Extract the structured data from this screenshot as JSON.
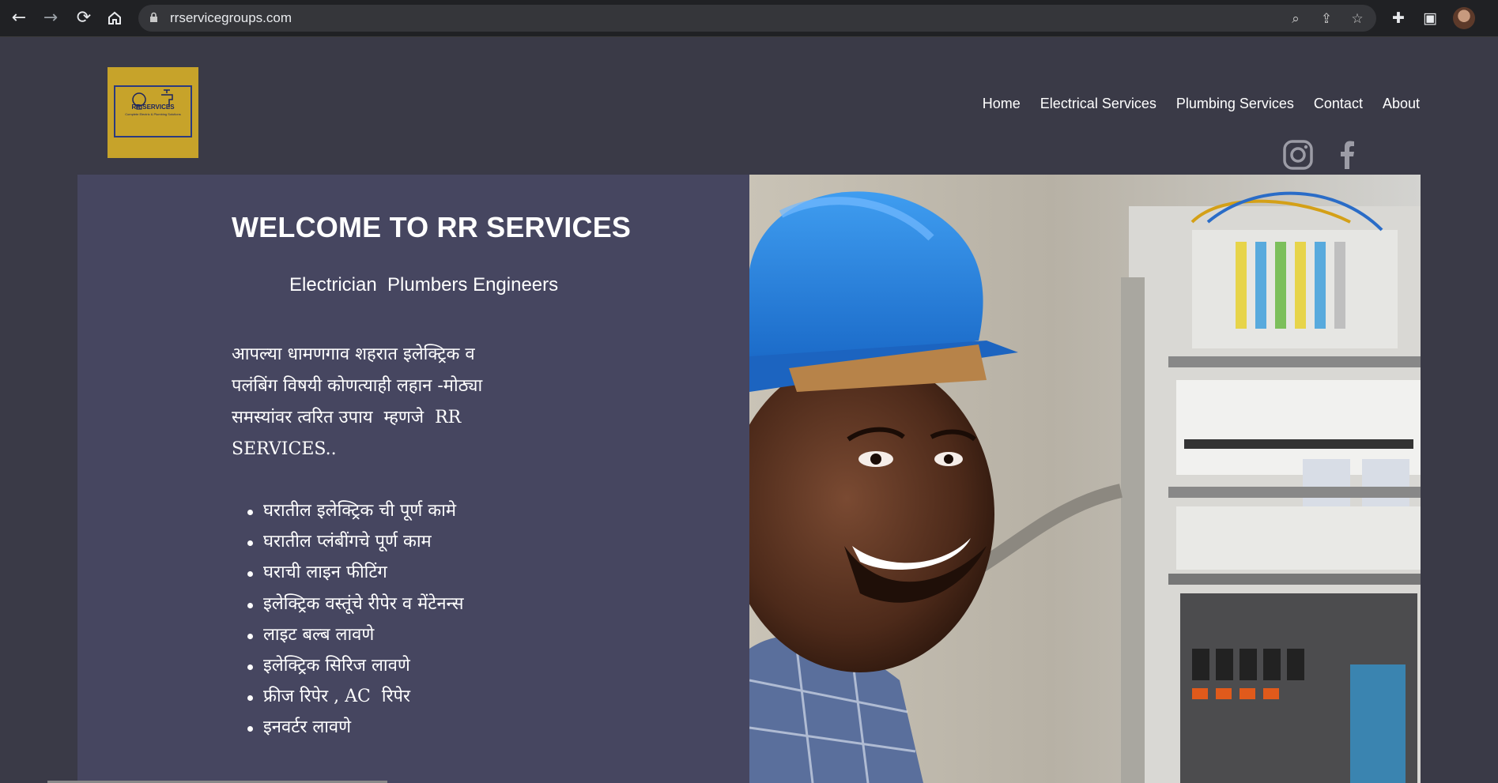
{
  "browser": {
    "url": "rrservicegroups.com"
  },
  "site": {
    "logo": {
      "title": "RR SERVICES",
      "tagline": "Complete Electric & Plumbing Solutions"
    },
    "menu": [
      "Home",
      "Electrical Services",
      "Plumbing Services",
      "Contact",
      "About"
    ],
    "social": [
      "instagram-icon",
      "facebook-icon"
    ]
  },
  "hero": {
    "welcome": "WELCOME TO RR SERVICES",
    "subtitle": "Electrician  Plumbers Engineers",
    "paragraph_lines": [
      "आपल्या धामणगाव शहरात इलेक्ट्रिक व",
      "पलंबिंग विषयी कोणत्याही लहान -मोठ्या",
      "समस्यांवर त्वरित उपाय  म्हणजे  RR",
      "SERVICES.."
    ],
    "services": [
      "घरातील इलेक्ट्रिक ची पूर्ण कामे",
      "घरातील प्लंबींगचे पूर्ण काम",
      "घराची लाइन फीटिंग",
      "इलेक्ट्रिक वस्तूंचे रीपेर व मेंटेनन्स",
      "लाइट बल्ब लावणे",
      "इलेक्ट्रिक सिरिज लावणे",
      "फ्रीज रिपेर , AC  रिपेर",
      "इनवर्टर लावणे"
    ]
  }
}
